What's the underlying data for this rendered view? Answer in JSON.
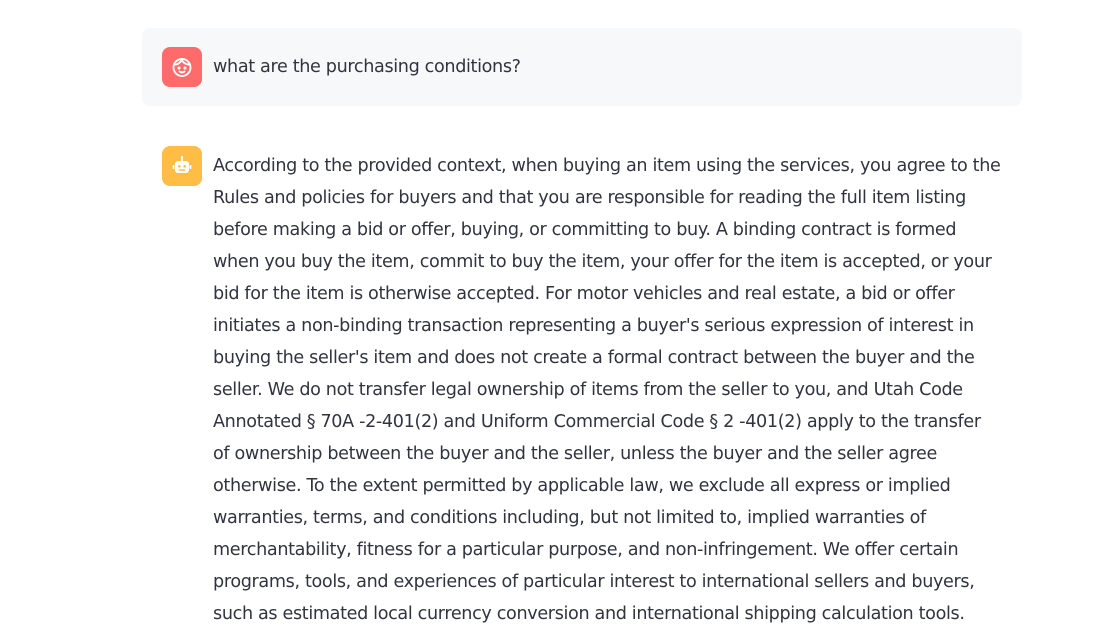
{
  "messages": {
    "user": {
      "avatar_icon": "face-icon",
      "avatar_color": "#ff6b6b",
      "text": "what are the purchasing conditions?"
    },
    "assistant": {
      "avatar_icon": "robot-icon",
      "avatar_color": "#ffbd45",
      "text": "According to the provided context, when buying an item using the services, you agree to the Rules and policies for buyers and that you are responsible for reading the full item listing before making a bid or offer, buying, or committing to buy. A binding contract is formed when you buy the item, commit to buy the item, your offer for the item is accepted, or your bid for the item is otherwise accepted. For motor vehicles and real estate, a bid or offer initiates a non-binding transaction representing a buyer's serious expression of interest in buying the seller's item and does not create a formal contract between the buyer and the seller. We do not transfer legal ownership of items from the seller to you, and Utah Code Annotated § 70A -2-401(2) and Uniform Commercial Code § 2 -401(2) apply to the transfer of ownership between the buyer and the seller, unless the buyer and the seller agree otherwise. To the extent permitted by applicable law, we exclude all express or implied warranties, terms, and conditions including, but not limited to, implied warranties of merchantability, fitness for a particular purpose, and non-infringement. We offer certain programs, tools, and experiences of particular interest to international sellers and buyers, such as estimated local currency conversion and international shipping calculation tools."
    }
  }
}
